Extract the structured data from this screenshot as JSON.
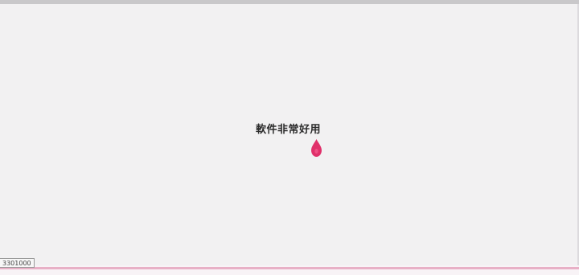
{
  "main": {
    "caption": "軟件非常好用"
  },
  "status": {
    "tag": "3301000"
  },
  "colors": {
    "background": "#f2f1f2",
    "accent": "#e0306a",
    "bottom_line": "#e8b0c6",
    "top_bar": "#c9c8ca"
  },
  "icons": {
    "cursor": "drop-pointer-icon"
  }
}
